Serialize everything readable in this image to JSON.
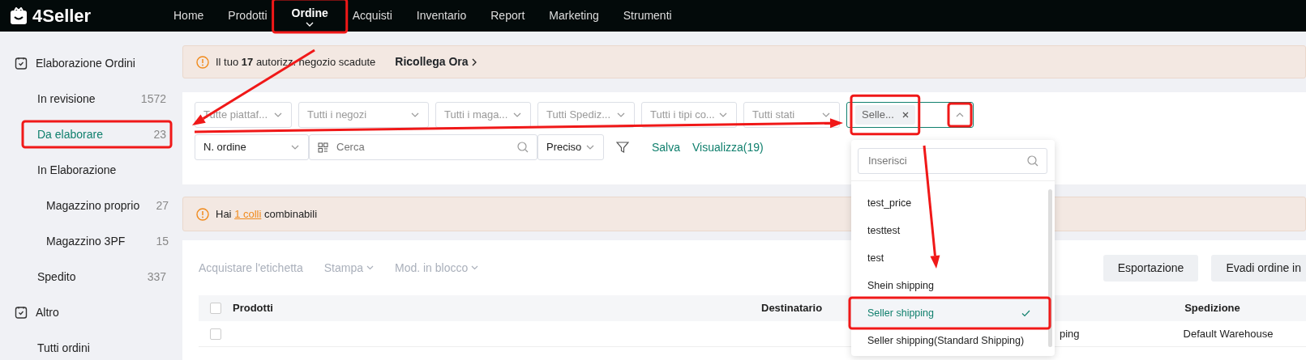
{
  "brand": "4Seller",
  "nav": [
    {
      "label": "Home",
      "selected": false
    },
    {
      "label": "Prodotti",
      "selected": false
    },
    {
      "label": "Ordine",
      "selected": true
    },
    {
      "label": "Acquisti",
      "selected": false
    },
    {
      "label": "Inventario",
      "selected": false
    },
    {
      "label": "Report",
      "selected": false
    },
    {
      "label": "Marketing",
      "selected": false
    },
    {
      "label": "Strumenti",
      "selected": false
    }
  ],
  "sidebar": {
    "groups": [
      {
        "label": "Elaborazione Ordini",
        "children": [
          {
            "label": "In revisione",
            "count": "1572",
            "selected": false
          },
          {
            "label": "Da elaborare",
            "count": "23",
            "selected": true
          },
          {
            "label": "In Elaborazione",
            "selected": false,
            "children": [
              {
                "label": "Magazzino proprio",
                "count": "27",
                "selected": false
              },
              {
                "label": "Magazzino 3PF",
                "count": "15",
                "selected": false
              }
            ]
          },
          {
            "label": "Spedito",
            "count": "337",
            "selected": false
          }
        ]
      },
      {
        "label": "Altro",
        "children": [
          {
            "label": "Tutti ordini",
            "selected": false
          }
        ]
      }
    ]
  },
  "alert": {
    "text": "Il tuo **17** autorizz. negozio scadute",
    "link": "Ricollega Ora"
  },
  "filters": [
    {
      "placeholder": "Tutte piattaf..."
    },
    {
      "placeholder": "Tutti i negozi"
    },
    {
      "placeholder": "Tutti i maga..."
    },
    {
      "placeholder": "Tutti Spediz..."
    },
    {
      "placeholder": "Tutti i tipi co..."
    },
    {
      "placeholder": "Tutti stati"
    }
  ],
  "shipping_filter": {
    "tag": "Selle...",
    "expanded": true,
    "dropdown": {
      "placeholder": "Inserisci",
      "options": [
        {
          "label": "test_price",
          "selected": false
        },
        {
          "label": "testtest",
          "selected": false
        },
        {
          "label": "test",
          "selected": false
        },
        {
          "label": "Shein shipping",
          "selected": false
        },
        {
          "label": "Seller shipping",
          "selected": true
        },
        {
          "label": "Seller shipping(Standard Shipping)",
          "selected": false
        }
      ]
    }
  },
  "search": {
    "field": "N. ordine",
    "placeholder": "Cerca",
    "mode": "Preciso"
  },
  "actions": [
    "Salva",
    "Visualizza(19)"
  ],
  "notice": {
    "before": "Hai",
    "link": "1 colli",
    "after": "combinabili"
  },
  "toolbar": [
    {
      "label": "Acquistare l'etichetta",
      "kind": "plain"
    },
    {
      "label": "Stampa",
      "kind": "menu"
    },
    {
      "label": "Mod. in blocco",
      "kind": "menu"
    }
  ],
  "buttons": [
    "Esportazione",
    "Evadi ordine in"
  ],
  "table": {
    "select_all": {
      "checked": false
    },
    "columns": [
      "Prodotti",
      "Destinatario",
      "Spedizione"
    ],
    "rows": [
      {
        "checked": false,
        "column_4": "ping",
        "spedizione": "Default Warehouse"
      }
    ]
  },
  "annotations": [
    {
      "kind": "box"
    },
    {
      "kind": "box"
    },
    {
      "kind": "box"
    },
    {
      "kind": "box"
    },
    {
      "kind": "box"
    },
    {
      "kind": "arrow"
    },
    {
      "kind": "arrow"
    },
    {
      "kind": "arrow"
    }
  ]
}
